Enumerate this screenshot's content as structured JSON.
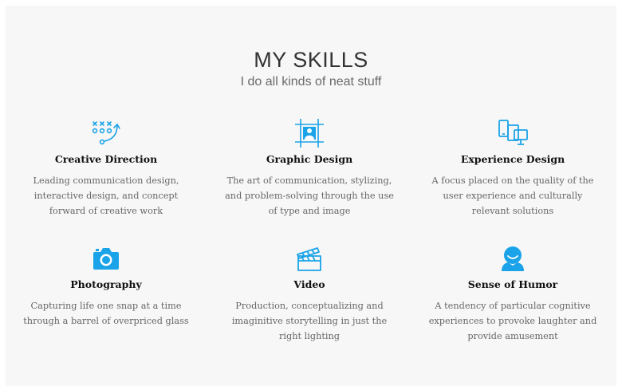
{
  "header": {
    "title": "MY SKILLS",
    "subtitle": "I do all kinds of neat stuff"
  },
  "colors": {
    "accent": "#1aa3e8",
    "panel_bg": "#f7f7f7"
  },
  "skills": [
    {
      "icon": "strategy-play-icon",
      "name": "Creative Direction",
      "description": "Leading communication design, interactive design, and concept forward of creative work"
    },
    {
      "icon": "picture-frame-icon",
      "name": "Graphic Design",
      "description": "The art of communication, stylizing, and problem-solving through the use of type and image"
    },
    {
      "icon": "devices-icon",
      "name": "Experience Design",
      "description": "A focus placed on the quality of the user experience and culturally relevant solutions"
    },
    {
      "icon": "camera-icon",
      "name": "Photography",
      "description": "Capturing life one snap at a time through a barrel of overpriced glass"
    },
    {
      "icon": "clapperboard-icon",
      "name": "Video",
      "description": "Production, conceptualizing and imaginitive storytelling in just the right lighting"
    },
    {
      "icon": "smiley-user-icon",
      "name": "Sense of Humor",
      "description": "A tendency of particular cognitive experiences to provoke laughter and provide amusement"
    }
  ]
}
